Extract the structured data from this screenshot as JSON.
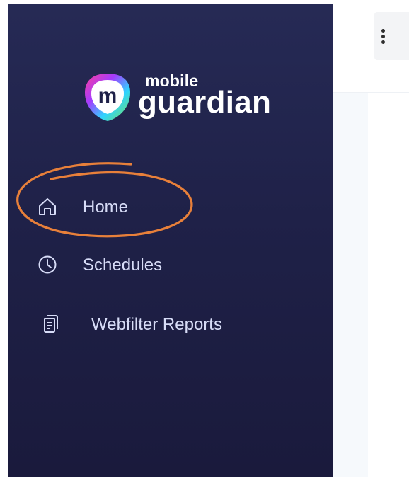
{
  "logo": {
    "small_text": "mobile",
    "big_text": "guardian",
    "mark_letter": "m"
  },
  "nav": {
    "items": [
      {
        "label": "Home",
        "icon": "home-icon"
      },
      {
        "label": "Schedules",
        "icon": "clock-icon"
      },
      {
        "label": "Webfilter Reports",
        "icon": "document-icon"
      }
    ]
  },
  "topbar": {
    "menu_icon": "vertical-dots-icon"
  },
  "colors": {
    "sidebar_top": "#262a55",
    "sidebar_bottom": "#1a1a3c",
    "nav_text": "#d7dcf7",
    "annotation": "#e8803a",
    "content_bg": "#f6f9fc"
  }
}
